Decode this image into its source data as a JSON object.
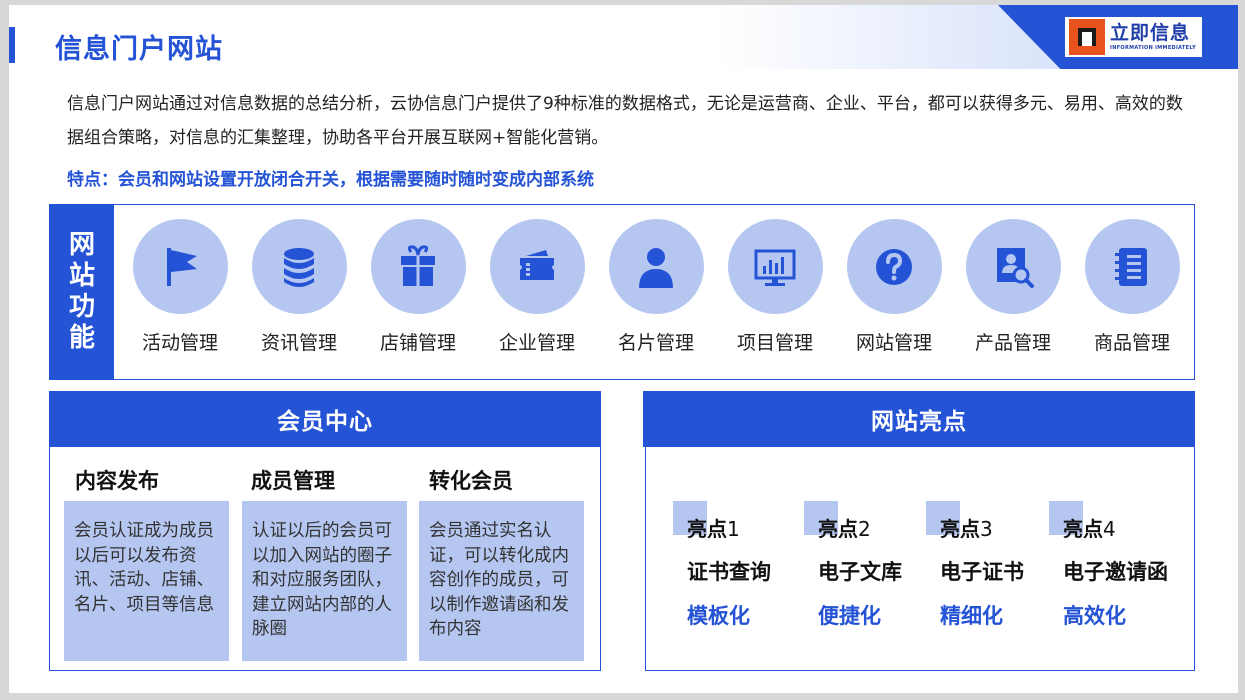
{
  "header": {
    "title": "信息门户网站",
    "logo_cn": "立即信息",
    "logo_en": "INFORMATION IMMEDIATELY"
  },
  "intro": "信息门户网站通过对信息数据的总结分析，云协信息门户提供了9种标准的数据格式，无论是运营商、企业、平台，都可以获得多元、易用、高效的数据组合策略，对信息的汇集整理，协助各平台开展互联网+智能化营销。",
  "feature": "特点：会员和网站设置开放闭合开关，根据需要随时随时变成内部系统",
  "functions": {
    "side": [
      "网",
      "站",
      "功",
      "能"
    ],
    "items": [
      {
        "label": "活动管理",
        "icon": "flag-icon"
      },
      {
        "label": "资讯管理",
        "icon": "database-icon"
      },
      {
        "label": "店铺管理",
        "icon": "gift-icon"
      },
      {
        "label": "企业管理",
        "icon": "ticket-icon"
      },
      {
        "label": "名片管理",
        "icon": "person-icon"
      },
      {
        "label": "项目管理",
        "icon": "monitor-chart-icon"
      },
      {
        "label": "网站管理",
        "icon": "question-icon"
      },
      {
        "label": "产品管理",
        "icon": "profile-search-icon"
      },
      {
        "label": "商品管理",
        "icon": "notebook-icon"
      }
    ]
  },
  "member_center": {
    "title": "会员中心",
    "columns": [
      {
        "title": "内容发布",
        "text": "会员认证成为成员以后可以发布资讯、活动、店铺、名片、项目等信息"
      },
      {
        "title": "成员管理",
        "text": "认证以后的会员可以加入网站的圈子和对应服务团队，建立网站内部的人脉圈"
      },
      {
        "title": "转化会员",
        "text": "会员通过实名认证，可以转化成内容创作的成员，可以制作邀请函和发布内容"
      }
    ]
  },
  "highlights": {
    "title": "网站亮点",
    "items": [
      {
        "name": "亮点",
        "num": "1",
        "item": "证书查询",
        "kind": "模板化"
      },
      {
        "name": "亮点",
        "num": "2",
        "item": "电子文库",
        "kind": "便捷化"
      },
      {
        "name": "亮点",
        "num": "3",
        "item": "电子证书",
        "kind": "精细化"
      },
      {
        "name": "亮点",
        "num": "4",
        "item": "电子邀请函",
        "kind": "高效化"
      }
    ]
  },
  "colors": {
    "accent": "#2553d6",
    "light": "#b5c7f1",
    "logo_orange": "#e8521d"
  }
}
